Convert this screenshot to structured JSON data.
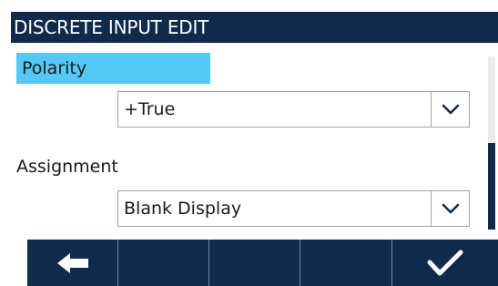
{
  "header": {
    "title": "DISCRETE INPUT EDIT"
  },
  "fields": [
    {
      "label": "Polarity",
      "value": "+True",
      "selected": true
    },
    {
      "label": "Assignment",
      "value": "Blank Display",
      "selected": false
    }
  ],
  "softkeys": [
    {
      "icon": "back-arrow-icon"
    },
    {
      "icon": ""
    },
    {
      "icon": ""
    },
    {
      "icon": ""
    },
    {
      "icon": "checkmark-icon"
    }
  ],
  "colors": {
    "header_bg": "#102a4c",
    "selection": "#55c8f5",
    "softkey_bg": "#102a4c"
  }
}
